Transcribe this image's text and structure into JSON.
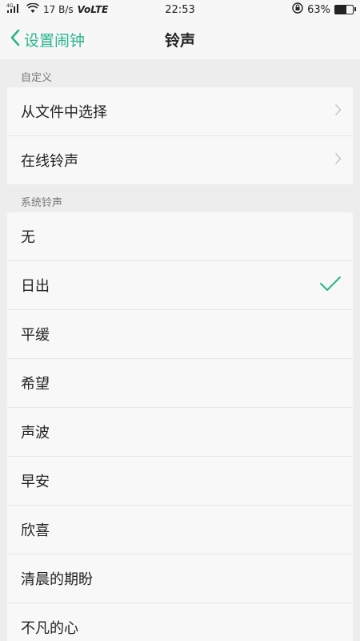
{
  "status": {
    "signal": "4G",
    "net_speed": "17 B/s",
    "volte": "VoLTE",
    "time": "22:53",
    "battery": "63%",
    "battery_level": 0.63
  },
  "nav": {
    "back_label": "设置闹钟",
    "title": "铃声"
  },
  "custom": {
    "header": "自定义",
    "items": [
      {
        "label": "从文件中选择"
      },
      {
        "label": "在线铃声"
      }
    ]
  },
  "system": {
    "header": "系统铃声",
    "items": [
      {
        "label": "无",
        "selected": false
      },
      {
        "label": "日出",
        "selected": true
      },
      {
        "label": "平缓",
        "selected": false
      },
      {
        "label": "希望",
        "selected": false
      },
      {
        "label": "声波",
        "selected": false
      },
      {
        "label": "早安",
        "selected": false
      },
      {
        "label": "欣喜",
        "selected": false
      },
      {
        "label": "清晨的期盼",
        "selected": false
      },
      {
        "label": "不凡的心",
        "selected": false
      }
    ]
  },
  "colors": {
    "accent": "#2bb58b"
  }
}
